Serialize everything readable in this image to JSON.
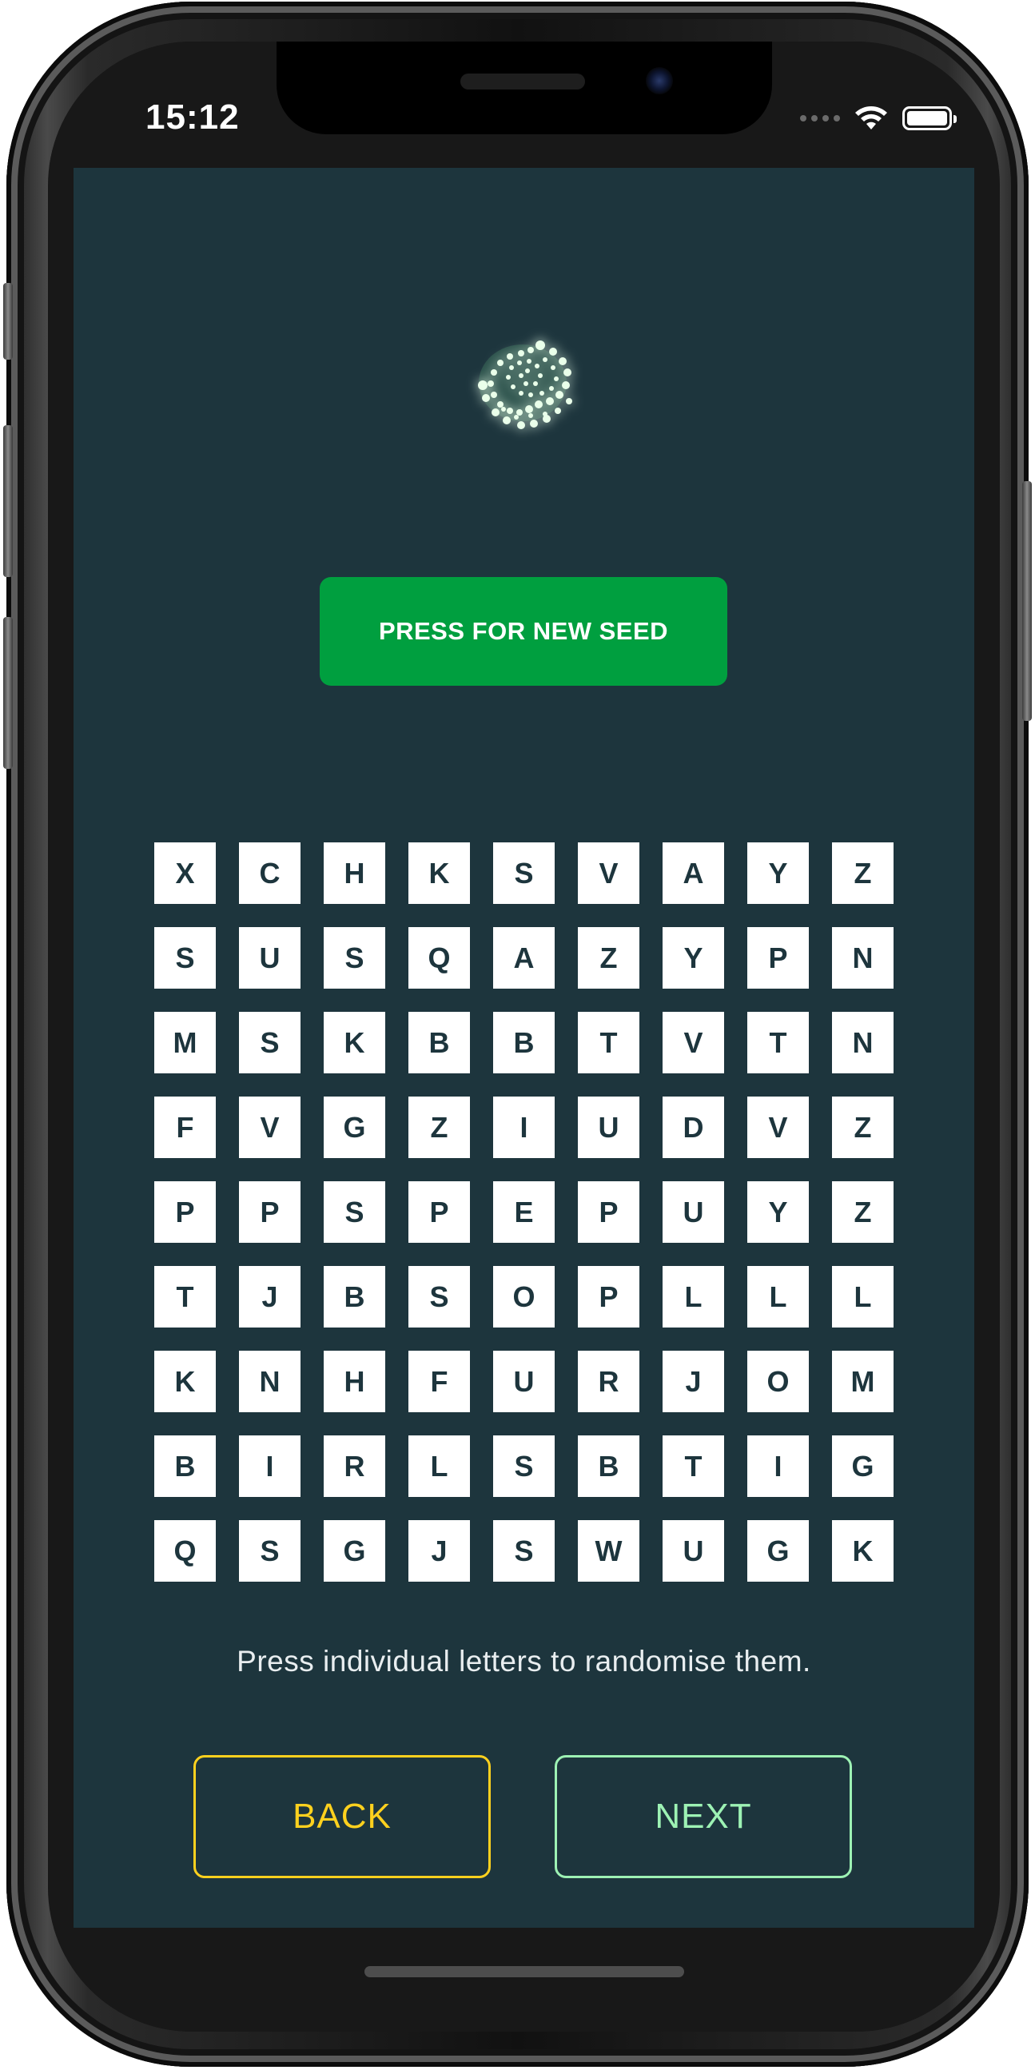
{
  "status_bar": {
    "time": "15:12",
    "icons": [
      "signal-dots-icon",
      "wifi-icon",
      "battery-icon"
    ]
  },
  "logo": {
    "icon": "iota-logo-icon",
    "color": "#b6f0b0"
  },
  "new_seed_button": {
    "label": "PRESS FOR NEW SEED",
    "color": "#009f3f"
  },
  "seed_grid": {
    "rows": [
      [
        "X",
        "C",
        "H",
        "K",
        "S",
        "V",
        "A",
        "Y",
        "Z"
      ],
      [
        "S",
        "U",
        "S",
        "Q",
        "A",
        "Z",
        "Y",
        "P",
        "N"
      ],
      [
        "M",
        "S",
        "K",
        "B",
        "B",
        "T",
        "V",
        "T",
        "N"
      ],
      [
        "F",
        "V",
        "G",
        "Z",
        "I",
        "U",
        "D",
        "V",
        "Z"
      ],
      [
        "P",
        "P",
        "S",
        "P",
        "E",
        "P",
        "U",
        "Y",
        "Z"
      ],
      [
        "T",
        "J",
        "B",
        "S",
        "O",
        "P",
        "L",
        "L",
        "L"
      ],
      [
        "K",
        "N",
        "H",
        "F",
        "U",
        "R",
        "J",
        "O",
        "M"
      ],
      [
        "B",
        "I",
        "R",
        "L",
        "S",
        "B",
        "T",
        "I",
        "G"
      ],
      [
        "Q",
        "S",
        "G",
        "J",
        "S",
        "W",
        "U",
        "G",
        "K"
      ]
    ]
  },
  "hint": "Press individual letters to randomise them.",
  "buttons": {
    "back": {
      "label": "BACK",
      "color": "#ffd11e"
    },
    "next": {
      "label": "NEXT",
      "color": "#9df2b4"
    }
  },
  "colors": {
    "background": "#1d353d",
    "cell": "#ffffff",
    "cell_text": "#1d353d"
  }
}
